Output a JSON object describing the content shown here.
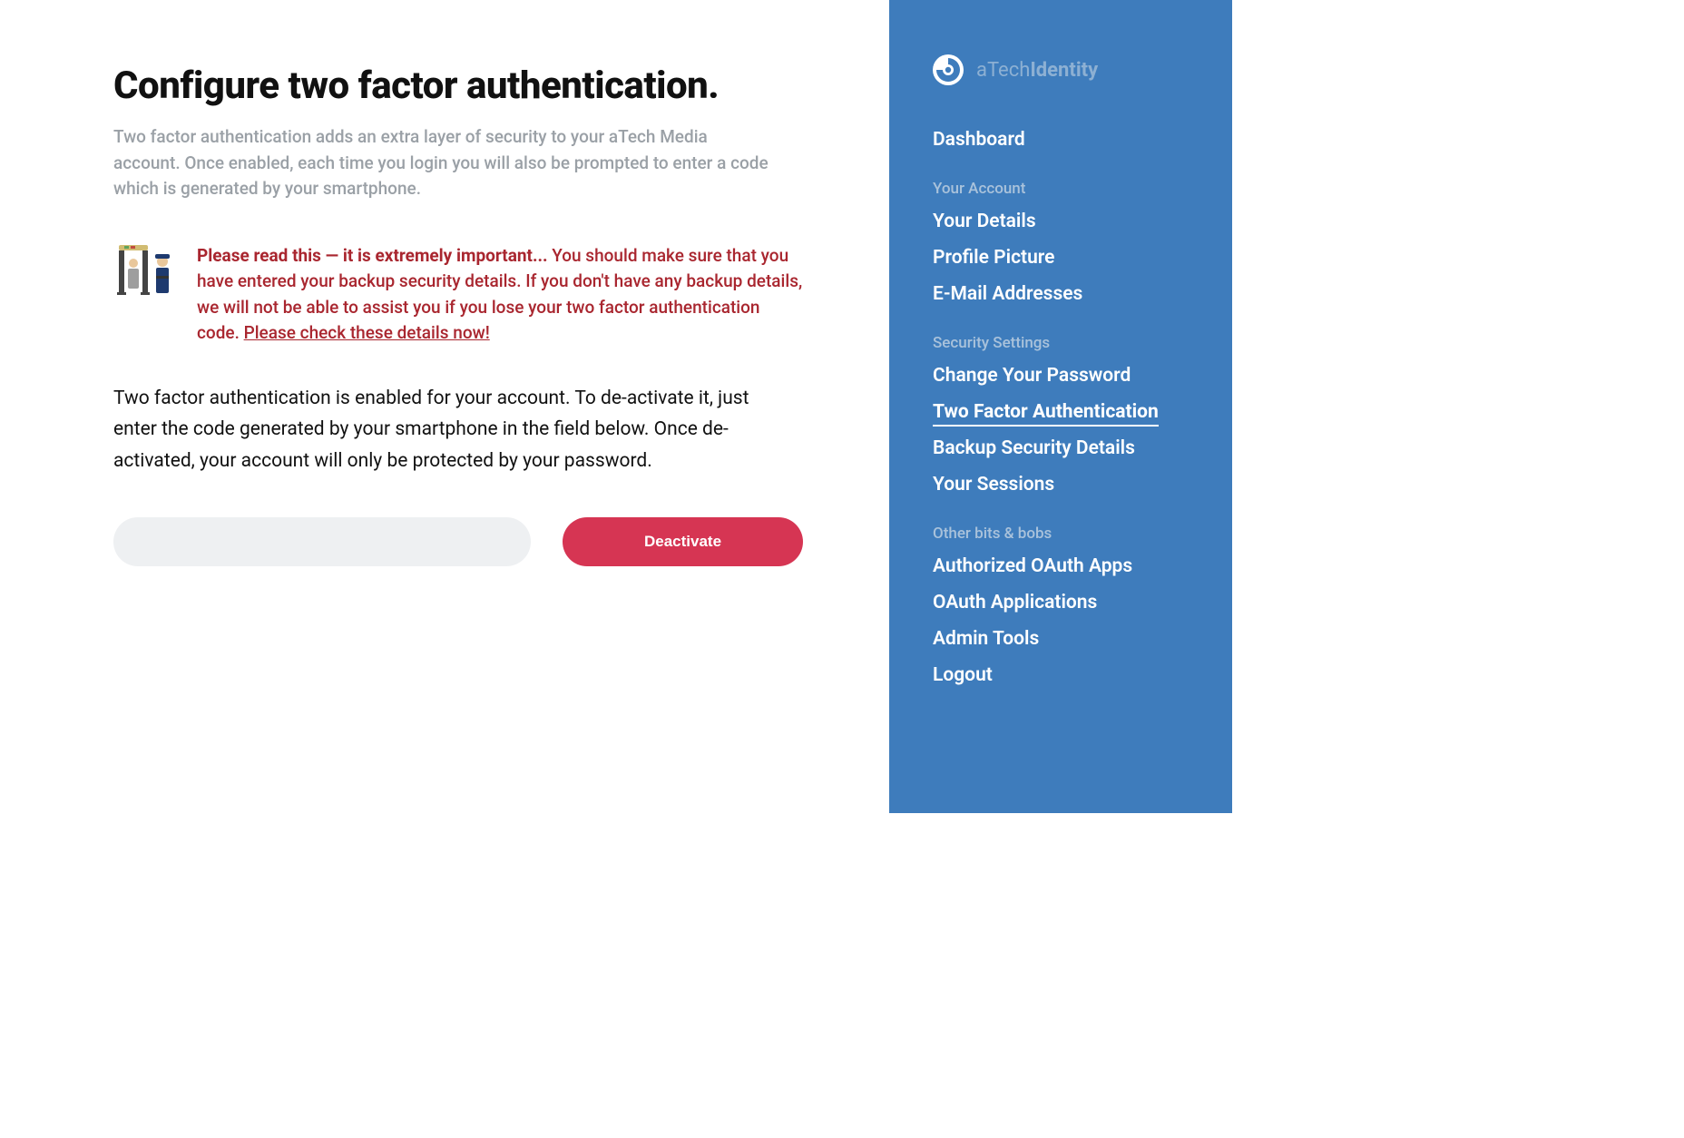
{
  "main": {
    "title": "Configure two factor authentication.",
    "subtitle": "Two factor authentication adds an extra layer of security to your aTech Media account. Once enabled, each time you login you will also be prompted to enter a code which is generated by your smartphone.",
    "warning": {
      "strong": "Please read this — it is extremely important...",
      "body": " You should make sure that you have entered your backup security details. If you don't have any backup details, we will not be able to assist you if you lose your two factor authentication code. ",
      "link": "Please check these details now!"
    },
    "body_text": "Two factor authentication is enabled for your account. To de-activate it, just enter the code generated by your smartphone in the field below. Once de-activated, your account will only be protected by your password.",
    "deactivate_button": "Deactivate",
    "code_placeholder": ""
  },
  "sidebar": {
    "brand_prefix": "aTech",
    "brand_suffix": "Identity",
    "dashboard": "Dashboard",
    "sections": [
      {
        "title": "Your Account",
        "items": [
          "Your Details",
          "Profile Picture",
          "E-Mail Addresses"
        ]
      },
      {
        "title": "Security Settings",
        "items": [
          "Change Your Password",
          "Two Factor Authentication",
          "Backup Security Details",
          "Your Sessions"
        ]
      },
      {
        "title": "Other bits & bobs",
        "items": [
          "Authorized OAuth Apps",
          "OAuth Applications",
          "Admin Tools",
          "Logout"
        ]
      }
    ]
  }
}
